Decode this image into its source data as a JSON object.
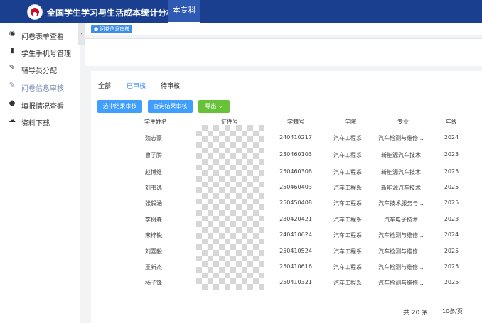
{
  "header": {
    "title": "全国学生学习与生活成本统计分析系统",
    "active_tab": "本专科"
  },
  "sidebar": {
    "items": [
      {
        "label": "问卷表单查看",
        "icon": "eye-icon"
      },
      {
        "label": "学生手机号管理",
        "icon": "bar-chart-icon"
      },
      {
        "label": "辅导员分配",
        "icon": "edit-icon"
      },
      {
        "label": "问卷信息审核",
        "icon": "edit-icon",
        "active": true
      },
      {
        "label": "填报情况查看",
        "icon": "user-icon"
      },
      {
        "label": "资料下载",
        "icon": "cloud-download-icon"
      }
    ]
  },
  "page_tab": "● 问卷信息审核",
  "filter_tabs": [
    "全部",
    "已审核",
    "待审核"
  ],
  "buttons": {
    "selected_result": "选中结果审核",
    "query_result": "查询结果审核",
    "export": "导出 ⌄"
  },
  "table": {
    "headers": [
      "学生姓名",
      "证件号",
      "学籍号",
      "学院",
      "专业",
      "年级"
    ],
    "rows": [
      {
        "name": "魏志豪",
        "student_no": "240410217",
        "college": "汽车工程系",
        "major": "汽车检测与维修...",
        "grade": "2024"
      },
      {
        "name": "曹子腾",
        "student_no": "230460103",
        "college": "汽车工程系",
        "major": "新能源汽车技术",
        "grade": "2023"
      },
      {
        "name": "赵博维",
        "student_no": "250460306",
        "college": "汽车工程系",
        "major": "新能源汽车技术",
        "grade": "2025"
      },
      {
        "name": "刘书逸",
        "student_no": "250460403",
        "college": "汽车工程系",
        "major": "新能源汽车技术",
        "grade": "2025"
      },
      {
        "name": "张毅涵",
        "student_no": "250450408",
        "college": "汽车工程系",
        "major": "汽车技术服务与...",
        "grade": "2025"
      },
      {
        "name": "李树森",
        "student_no": "230420421",
        "college": "汽车工程系",
        "major": "汽车电子技术",
        "grade": "2023"
      },
      {
        "name": "宋梓锐",
        "student_no": "240410624",
        "college": "汽车工程系",
        "major": "汽车检测与维修...",
        "grade": "2024"
      },
      {
        "name": "刘嘉毅",
        "student_no": "250410524",
        "college": "汽车工程系",
        "major": "汽车检测与维修...",
        "grade": "2025"
      },
      {
        "name": "王新杰",
        "student_no": "250410616",
        "college": "汽车工程系",
        "major": "汽车检测与维修...",
        "grade": "2025"
      },
      {
        "name": "杨子锋",
        "student_no": "250410321",
        "college": "汽车工程系",
        "major": "汽车检测与维修...",
        "grade": "2025"
      }
    ]
  },
  "pagination": {
    "total": "共 20 条",
    "page_size": "10条/页"
  }
}
